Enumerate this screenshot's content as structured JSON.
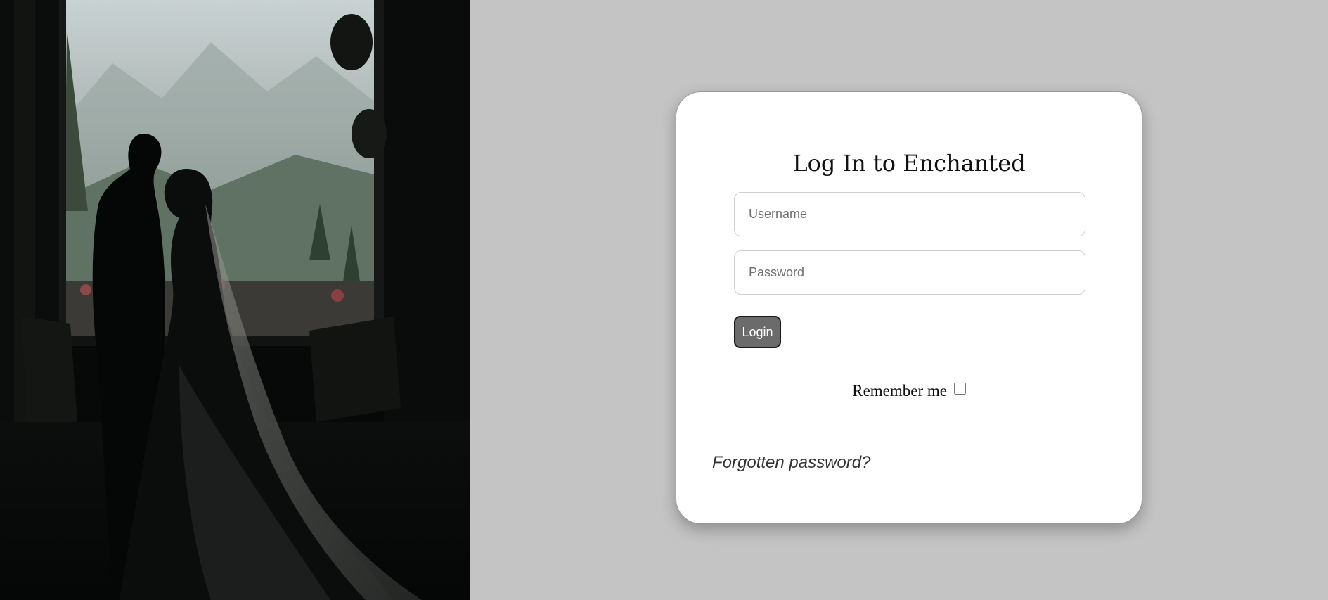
{
  "login": {
    "title": "Log In to Enchanted",
    "username_placeholder": "Username",
    "password_placeholder": "Password",
    "login_label": "Login",
    "remember_label": "Remember me",
    "remember_checked": false,
    "forgot_label": "Forgotten password?"
  },
  "colors": {
    "page_background": "#c4c4c4",
    "card_background": "#ffffff",
    "button_background": "#6b6b6b"
  }
}
